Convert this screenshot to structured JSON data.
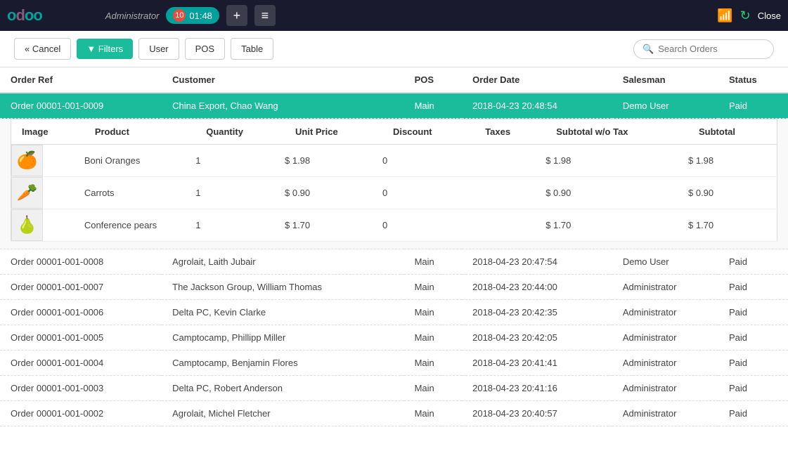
{
  "topbar": {
    "logo": "odoo",
    "admin_label": "Administrator",
    "tab": {
      "number": "10",
      "time": "01:48"
    },
    "add_btn": "+",
    "menu_btn": "≡",
    "close_label": "Close"
  },
  "toolbar": {
    "cancel_label": "« Cancel",
    "filters_label": "Filters",
    "user_label": "User",
    "pos_label": "POS",
    "table_label": "Table",
    "search_placeholder": "Search Orders"
  },
  "table_headers": {
    "order_ref": "Order Ref",
    "customer": "Customer",
    "pos": "POS",
    "order_date": "Order Date",
    "salesman": "Salesman",
    "status": "Status"
  },
  "product_table_headers": {
    "image": "Image",
    "product": "Product",
    "quantity": "Quantity",
    "unit_price": "Unit Price",
    "discount": "Discount",
    "taxes": "Taxes",
    "subtotal_wo_tax": "Subtotal w/o Tax",
    "subtotal": "Subtotal"
  },
  "orders": [
    {
      "id": "00001-001-0009",
      "ref": "Order 00001-001-0009",
      "customer": "China Export, Chao Wang",
      "pos": "Main",
      "order_date": "2018-04-23 20:48:54",
      "salesman": "Demo User",
      "status": "Paid",
      "selected": true,
      "products": [
        {
          "icon": "🍊",
          "name": "Boni Oranges",
          "quantity": "1",
          "unit_price": "$ 1.98",
          "discount": "0",
          "taxes": "",
          "subtotal_wo_tax": "$ 1.98",
          "subtotal": "$ 1.98"
        },
        {
          "icon": "🥕",
          "name": "Carrots",
          "quantity": "1",
          "unit_price": "$ 0.90",
          "discount": "0",
          "taxes": "",
          "subtotal_wo_tax": "$ 0.90",
          "subtotal": "$ 0.90"
        },
        {
          "icon": "🍐",
          "name": "Conference pears",
          "quantity": "1",
          "unit_price": "$ 1.70",
          "discount": "0",
          "taxes": "",
          "subtotal_wo_tax": "$ 1.70",
          "subtotal": "$ 1.70"
        }
      ]
    },
    {
      "id": "00001-001-0008",
      "ref": "Order 00001-001-0008",
      "customer": "Agrolait, Laith Jubair",
      "pos": "Main",
      "order_date": "2018-04-23 20:47:54",
      "salesman": "Demo User",
      "status": "Paid",
      "selected": false
    },
    {
      "id": "00001-001-0007",
      "ref": "Order 00001-001-0007",
      "customer": "The Jackson Group, William Thomas",
      "pos": "Main",
      "order_date": "2018-04-23 20:44:00",
      "salesman": "Administrator",
      "status": "Paid",
      "selected": false
    },
    {
      "id": "00001-001-0006",
      "ref": "Order 00001-001-0006",
      "customer": "Delta PC, Kevin Clarke",
      "pos": "Main",
      "order_date": "2018-04-23 20:42:35",
      "salesman": "Administrator",
      "status": "Paid",
      "selected": false
    },
    {
      "id": "00001-001-0005",
      "ref": "Order 00001-001-0005",
      "customer": "Camptocamp, Phillipp Miller",
      "pos": "Main",
      "order_date": "2018-04-23 20:42:05",
      "salesman": "Administrator",
      "status": "Paid",
      "selected": false
    },
    {
      "id": "00001-001-0004",
      "ref": "Order 00001-001-0004",
      "customer": "Camptocamp, Benjamin Flores",
      "pos": "Main",
      "order_date": "2018-04-23 20:41:41",
      "salesman": "Administrator",
      "status": "Paid",
      "selected": false
    },
    {
      "id": "00001-001-0003",
      "ref": "Order 00001-001-0003",
      "customer": "Delta PC, Robert Anderson",
      "pos": "Main",
      "order_date": "2018-04-23 20:41:16",
      "salesman": "Administrator",
      "status": "Paid",
      "selected": false
    },
    {
      "id": "00001-001-0002",
      "ref": "Order 00001-001-0002",
      "customer": "Agrolait, Michel Fletcher",
      "pos": "Main",
      "order_date": "2018-04-23 20:40:57",
      "salesman": "Administrator",
      "status": "Paid",
      "selected": false
    }
  ]
}
